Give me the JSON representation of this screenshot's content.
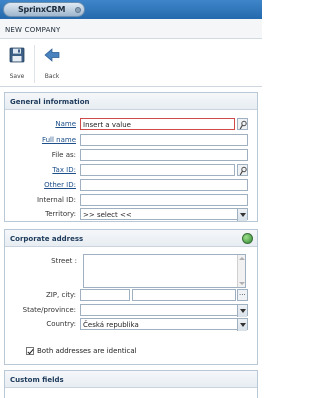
{
  "app": {
    "logo_text": "SprinxCRM"
  },
  "page": {
    "title": "NEW COMPANY"
  },
  "toolbar": {
    "save_label": "Save",
    "back_label": "Back"
  },
  "general": {
    "title": "General information",
    "name": {
      "label": "Name",
      "value": "Insert a value"
    },
    "full_name": {
      "label": "Full name",
      "value": ""
    },
    "file_as": {
      "label": "File as:",
      "value": ""
    },
    "tax_id": {
      "label": "Tax ID:",
      "value": ""
    },
    "other_id": {
      "label": "Other ID:",
      "value": ""
    },
    "internal_id": {
      "label": "Internal ID:",
      "value": ""
    },
    "territory": {
      "label": "Territory:",
      "value": ">> select <<"
    }
  },
  "corporate": {
    "title": "Corporate address",
    "street_label": "Street :",
    "zip_label": "ZIP, city:",
    "zip_more": "...",
    "state_label": "State/province:",
    "country_label": "Country:",
    "country_value": "Česká republika",
    "identical_label": "Both addresses are identical"
  },
  "custom": {
    "title": "Custom fields"
  },
  "colors": {
    "topbar": "#2f76bb",
    "accent": "#1d4f8a",
    "active_border": "#d04a4a",
    "section_border": "#b9c8d6"
  },
  "icons": {
    "save": "floppy-disk-icon",
    "back": "arrow-left-icon",
    "picker": "binoculars-icon",
    "corporate": "globe-icon"
  }
}
